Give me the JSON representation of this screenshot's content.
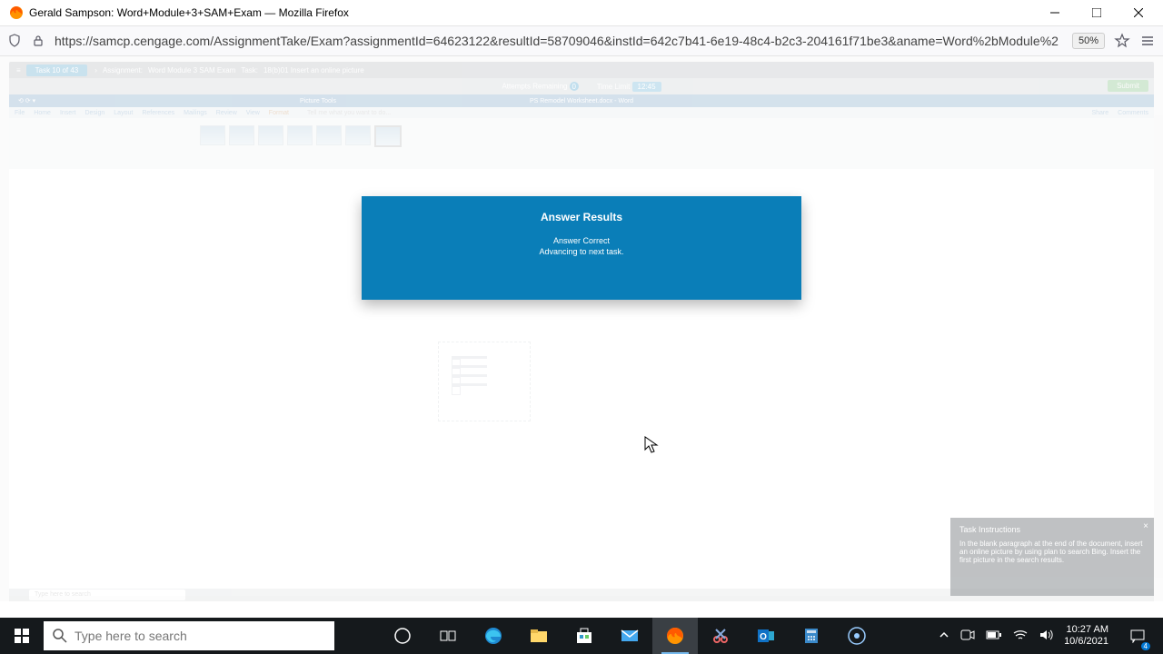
{
  "window": {
    "title": "Gerald Sampson: Word+Module+3+SAM+Exam — Mozilla Firefox"
  },
  "browser": {
    "url": "https://samcp.cengage.com/AssignmentTake/Exam?assignmentId=64623122&resultId=58709046&instId=642c7b41-6e19-48c4-b2c3-204161f71be3&aname=Word%2bModule%2",
    "zoom": "50%"
  },
  "sam": {
    "task_counter": "Task 10 of 43",
    "assignment_label": "Assignment:",
    "assignment_name": "Word Module 3 SAM Exam",
    "task_label": "Task:",
    "task_name": "18(b)01 Insert an online picture",
    "attempts_label": "Attempts Remaining",
    "attempts_value": "0",
    "timelimit_label": "Time Limit",
    "timelimit_value": "12:45",
    "submit": "Submit"
  },
  "word": {
    "doc_title": "PS Remodel Worksheet.docx - Word",
    "context_tab": "Picture Tools",
    "tabs": [
      "File",
      "Home",
      "Insert",
      "Design",
      "Layout",
      "References",
      "Mailings",
      "Review",
      "View",
      "Format"
    ],
    "tell_me": "Tell me what you want to do...",
    "share": "Share",
    "comments": "Comments"
  },
  "modal": {
    "title": "Answer Results",
    "line1": "Answer Correct",
    "line2": "Advancing to next task."
  },
  "instructions": {
    "title": "Task Instructions",
    "body": "In the blank paragraph at the end of the document, insert an online picture by using plan to search Bing. Insert the first picture in the search results."
  },
  "inner_taskbar": {
    "search": "Type here to search"
  },
  "taskbar": {
    "search_placeholder": "Type here to search",
    "time": "10:27 AM",
    "date": "10/6/2021",
    "notif_count": "4"
  }
}
